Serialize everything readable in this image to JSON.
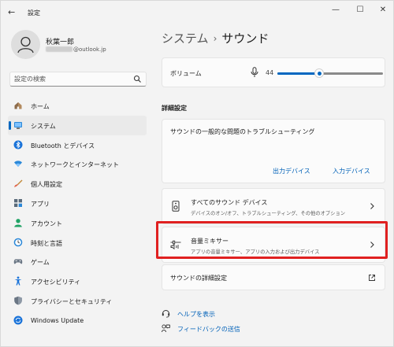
{
  "window": {
    "back_glyph": "←",
    "title": "設定",
    "minimize_glyph": "—",
    "maximize_glyph": "☐",
    "close_glyph": "✕"
  },
  "user": {
    "name": "秋葉一郎",
    "email_suffix": "@outlook.jp"
  },
  "search": {
    "placeholder": "設定の検索"
  },
  "sidebar": {
    "items": [
      {
        "label": "ホーム",
        "icon": "home-icon"
      },
      {
        "label": "システム",
        "icon": "system-icon",
        "active": true
      },
      {
        "label": "Bluetooth とデバイス",
        "icon": "bluetooth-icon"
      },
      {
        "label": "ネットワークとインターネット",
        "icon": "network-icon"
      },
      {
        "label": "個人用設定",
        "icon": "brush-icon"
      },
      {
        "label": "アプリ",
        "icon": "apps-icon"
      },
      {
        "label": "アカウント",
        "icon": "account-icon"
      },
      {
        "label": "時刻と言語",
        "icon": "time-language-icon"
      },
      {
        "label": "ゲーム",
        "icon": "gamepad-icon"
      },
      {
        "label": "アクセシビリティ",
        "icon": "accessibility-icon"
      },
      {
        "label": "プライバシーとセキュリティ",
        "icon": "shield-icon"
      },
      {
        "label": "Windows Update",
        "icon": "update-icon"
      }
    ]
  },
  "breadcrumb": {
    "parent": "システム",
    "separator": "›",
    "current": "サウンド"
  },
  "volume": {
    "label": "ボリューム",
    "value": "44",
    "level": 44
  },
  "advanced": {
    "title": "詳細設定",
    "troubleshoot": {
      "text": "サウンドの一般的な問題のトラブルシューティング",
      "output_button": "出力デバイス",
      "input_button": "入力デバイス"
    },
    "all_devices": {
      "title": "すべてのサウンド デバイス",
      "subtitle": "デバイスのオン/オフ、トラブルシューティング、その他のオプション"
    },
    "mixer": {
      "title": "音量ミキサー",
      "subtitle": "アプリの音量ミキサー、アプリの入力および出力デバイス"
    },
    "more_settings": "サウンドの詳細設定"
  },
  "help": {
    "get_help": "ヘルプを表示",
    "feedback": "フィードバックの送信"
  },
  "colors": {
    "accent": "#0067c0",
    "highlight": "#e02020"
  }
}
